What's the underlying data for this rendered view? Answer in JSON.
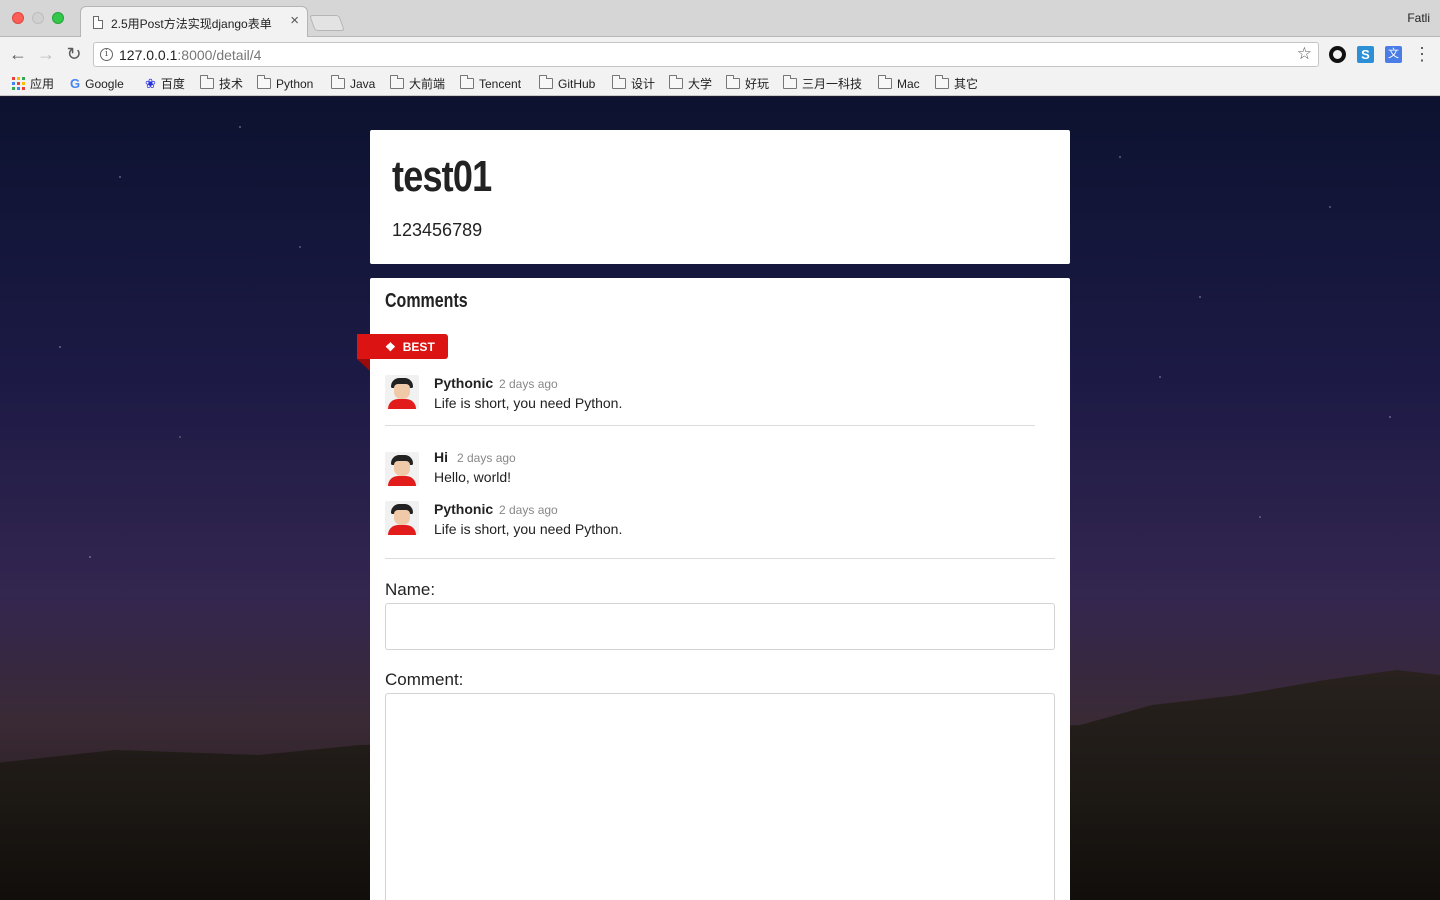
{
  "browser": {
    "tab_title": "2.5用Post方法实现django表单",
    "tab_close": "×",
    "profile_name": "Fatli",
    "url_host": "127.0.0.1",
    "url_rest": ":8000/detail/4",
    "bookmarks": [
      {
        "label": "应用",
        "icon": "apps-icon"
      },
      {
        "label": "Google",
        "icon": "google-icon"
      },
      {
        "label": "百度",
        "icon": "baidu-icon"
      },
      {
        "label": "技术",
        "icon": "folder-icon"
      },
      {
        "label": "Python",
        "icon": "folder-icon"
      },
      {
        "label": "Java",
        "icon": "folder-icon"
      },
      {
        "label": "大前端",
        "icon": "folder-icon"
      },
      {
        "label": "Tencent",
        "icon": "folder-icon"
      },
      {
        "label": "GitHub",
        "icon": "folder-icon"
      },
      {
        "label": "设计",
        "icon": "folder-icon"
      },
      {
        "label": "大学",
        "icon": "folder-icon"
      },
      {
        "label": "好玩",
        "icon": "folder-icon"
      },
      {
        "label": "三月一科技",
        "icon": "folder-icon"
      },
      {
        "label": "Mac",
        "icon": "folder-icon"
      },
      {
        "label": "其它",
        "icon": "folder-icon"
      }
    ]
  },
  "post": {
    "title": "test01",
    "content": "123456789"
  },
  "comments": {
    "header": "Comments",
    "best_label": "BEST",
    "best": {
      "author": "Pythonic",
      "time": "2 days ago",
      "text": "Life is short, you need Python."
    },
    "list": [
      {
        "author": "Hi",
        "time": "2 days ago",
        "text": "Hello, world!"
      },
      {
        "author": "Pythonic",
        "time": "2 days ago",
        "text": "Life is short, you need Python."
      }
    ]
  },
  "form": {
    "name_label": "Name:",
    "name_value": "",
    "comment_label": "Comment:",
    "comment_value": ""
  },
  "colors": {
    "accent": "#db1313"
  }
}
